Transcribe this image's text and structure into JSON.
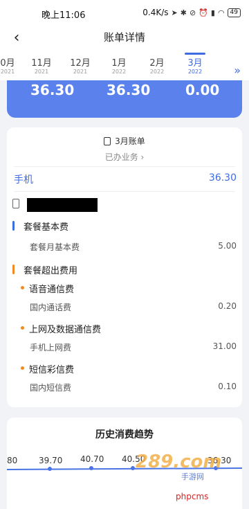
{
  "status_bar": {
    "time": "晚上11:06",
    "network_speed": "0.4K/s",
    "battery": "49",
    "icons": [
      "location-icon",
      "bluetooth-icon",
      "mute-icon",
      "alarm-icon",
      "signal-icon",
      "wifi-icon"
    ]
  },
  "header": {
    "title": "账单详情",
    "back_icon": "chevron-left-icon"
  },
  "months": [
    {
      "label": "0月",
      "year": "2021"
    },
    {
      "label": "11月",
      "year": "2021"
    },
    {
      "label": "12月",
      "year": "2021"
    },
    {
      "label": "1月",
      "year": "2022"
    },
    {
      "label": "2月",
      "year": "2022"
    },
    {
      "label": "3月",
      "year": "2022",
      "active": true
    }
  ],
  "more_icon": "double-chevron-right-icon",
  "summary": {
    "values": [
      "36.30",
      "36.30",
      "0.00"
    ]
  },
  "bill": {
    "title": "3月账单",
    "business_link": "已办业务 ›",
    "phone_label": "手机",
    "phone_total": "36.30",
    "sections": {
      "basic": {
        "title": "套餐基本费",
        "color": "#3d6be0",
        "items": [
          {
            "label": "套餐月基本费",
            "value": "5.00"
          }
        ]
      },
      "extra": {
        "title": "套餐超出费用",
        "color": "#f08a24",
        "groups": [
          {
            "title": "语音通信费",
            "items": [
              {
                "label": "国内通话费",
                "value": "0.20"
              }
            ]
          },
          {
            "title": "上网及数据通信费",
            "items": [
              {
                "label": "手机上网费",
                "value": "31.00"
              }
            ]
          },
          {
            "title": "短信彩信费",
            "items": [
              {
                "label": "国内短信费",
                "value": "0.10"
              }
            ]
          }
        ]
      }
    }
  },
  "trend": {
    "title": "历史消费趋势",
    "points": [
      "80",
      "39.70",
      "40.70",
      "40.50",
      "36.30"
    ]
  },
  "watermark": {
    "logo": "289.com",
    "sub": "手游网",
    "site": "phpcms"
  }
}
